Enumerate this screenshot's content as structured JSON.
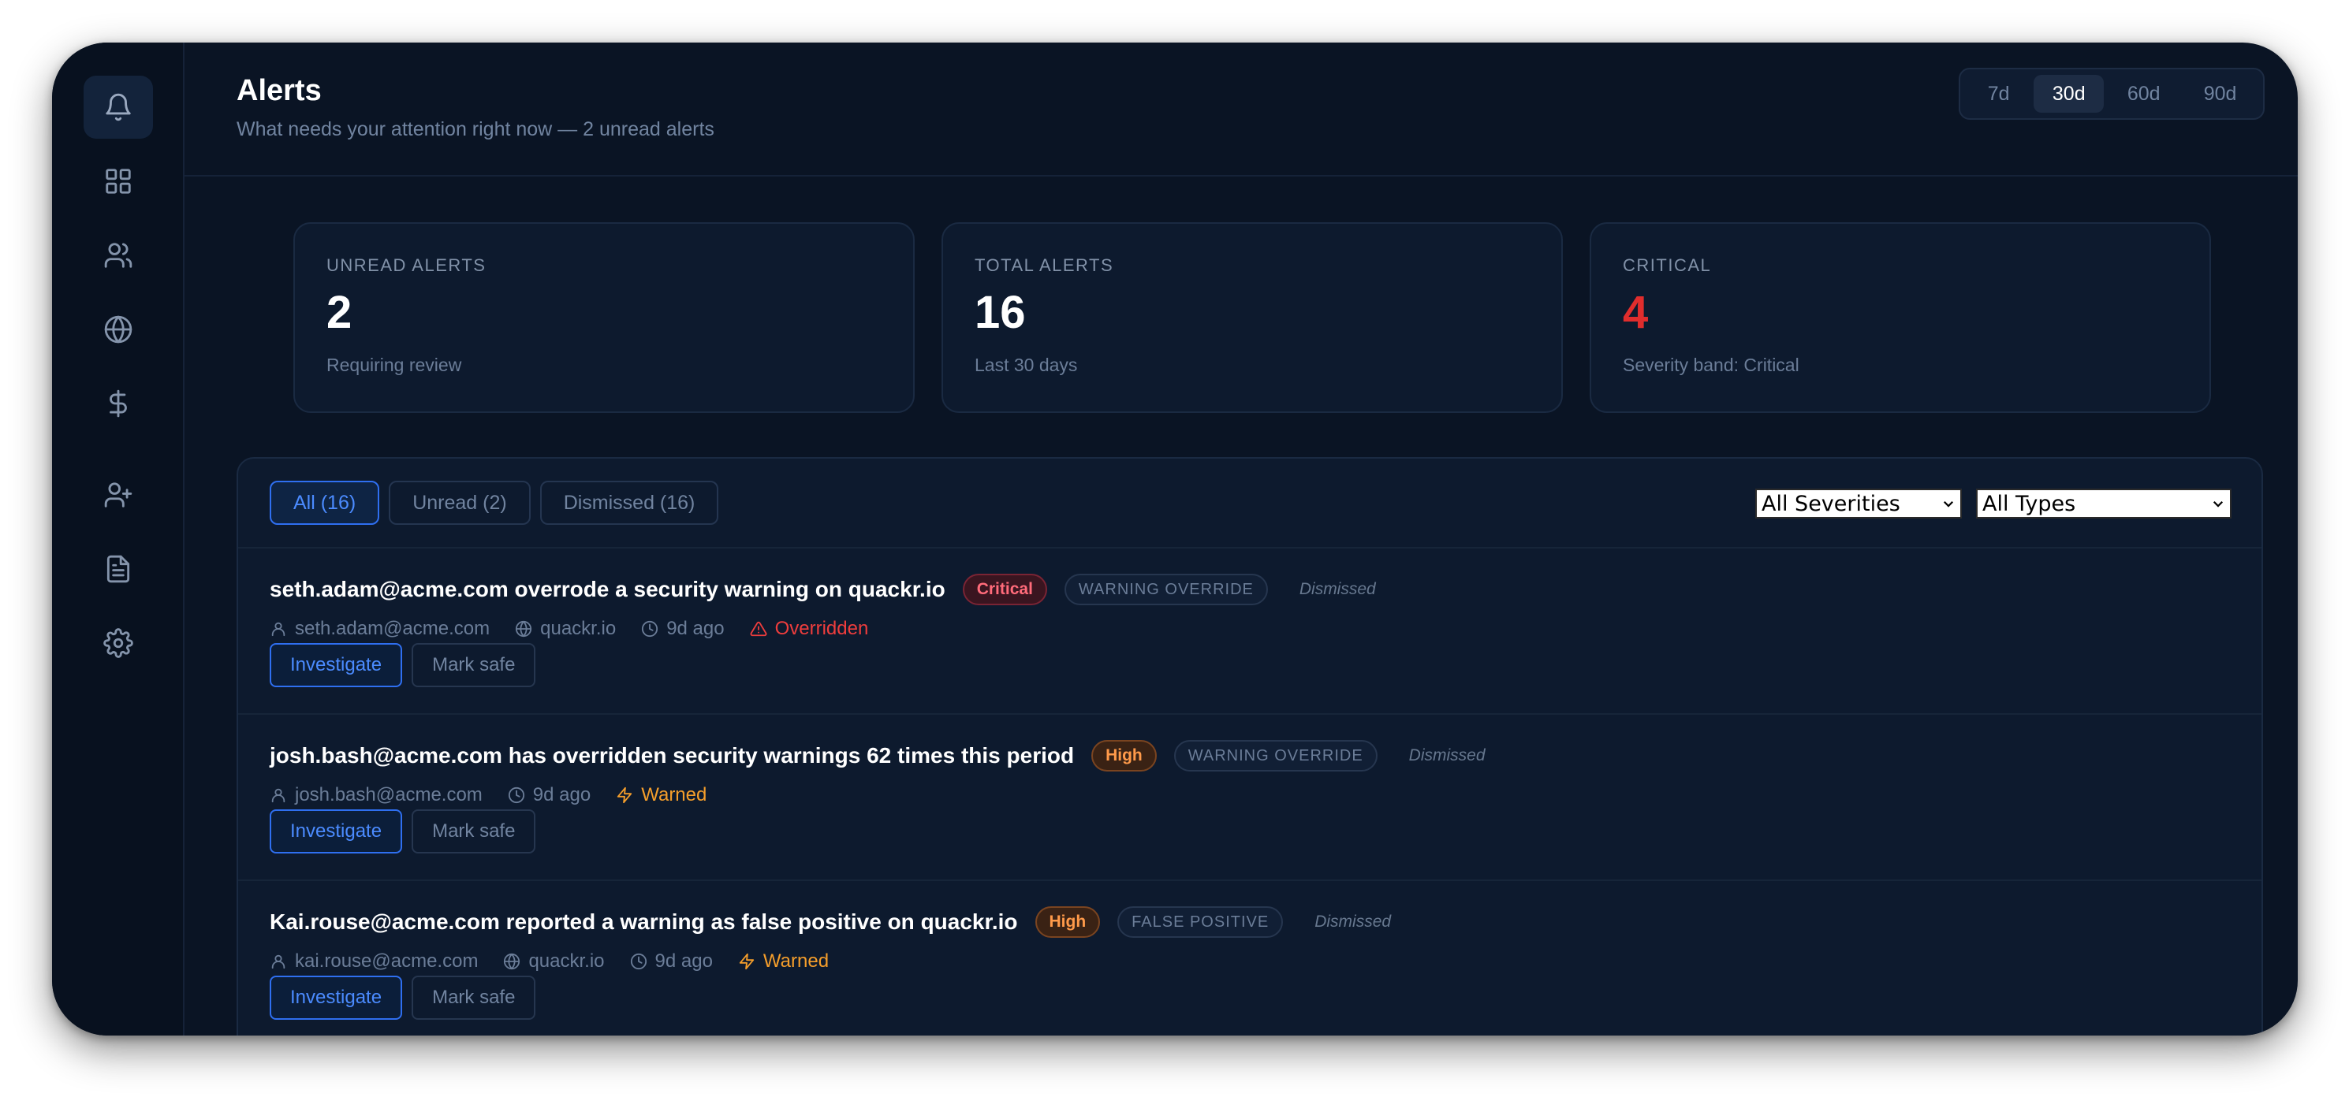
{
  "header": {
    "title": "Alerts",
    "subtitle": "What needs your attention right now — 2 unread alerts"
  },
  "range": {
    "options": [
      "7d",
      "30d",
      "60d",
      "90d"
    ],
    "selected": "30d"
  },
  "sidebar": {
    "icons": [
      "bell-icon",
      "grid-icon",
      "users-icon",
      "globe-icon",
      "dollar-icon",
      "user-plus-icon",
      "document-icon",
      "gear-icon"
    ],
    "active": "bell-icon"
  },
  "stats": [
    {
      "label": "UNREAD ALERTS",
      "value": "2",
      "note": "Requiring review"
    },
    {
      "label": "TOTAL ALERTS",
      "value": "16",
      "note": "Last 30 days"
    },
    {
      "label": "CRITICAL",
      "value": "4",
      "note": "Severity band: Critical"
    }
  ],
  "tabs": [
    {
      "label": "All (16)",
      "active": true
    },
    {
      "label": "Unread (2)",
      "active": false
    },
    {
      "label": "Dismissed (16)",
      "active": false
    }
  ],
  "filters": {
    "severity": "All Severities",
    "type": "All Types"
  },
  "alerts": [
    {
      "title": "seth.adam@acme.com overrode a security warning on quackr.io",
      "severity": "Critical",
      "type": "WARNING OVERRIDE",
      "status": "Dismissed",
      "user": "seth.adam@acme.com",
      "domain": "quackr.io",
      "time": "9d ago",
      "outcome": "Overridden"
    },
    {
      "title": "josh.bash@acme.com has overridden security warnings 62 times this period",
      "severity": "High",
      "type": "WARNING OVERRIDE",
      "status": "Dismissed",
      "user": "josh.bash@acme.com",
      "time": "9d ago",
      "outcome": "Warned"
    },
    {
      "title": "Kai.rouse@acme.com reported a warning as false positive on quackr.io",
      "severity": "High",
      "type": "FALSE POSITIVE",
      "status": "Dismissed",
      "user": "kai.rouse@acme.com",
      "domain": "quackr.io",
      "time": "9d ago",
      "outcome": "Warned"
    }
  ],
  "actions": {
    "investigate": "Investigate",
    "mark_safe": "Mark safe"
  },
  "colors": {
    "accent": "#2f6ff0",
    "critical": "#e02d2d",
    "warning": "#f59e2b",
    "background": "#0a1424"
  }
}
